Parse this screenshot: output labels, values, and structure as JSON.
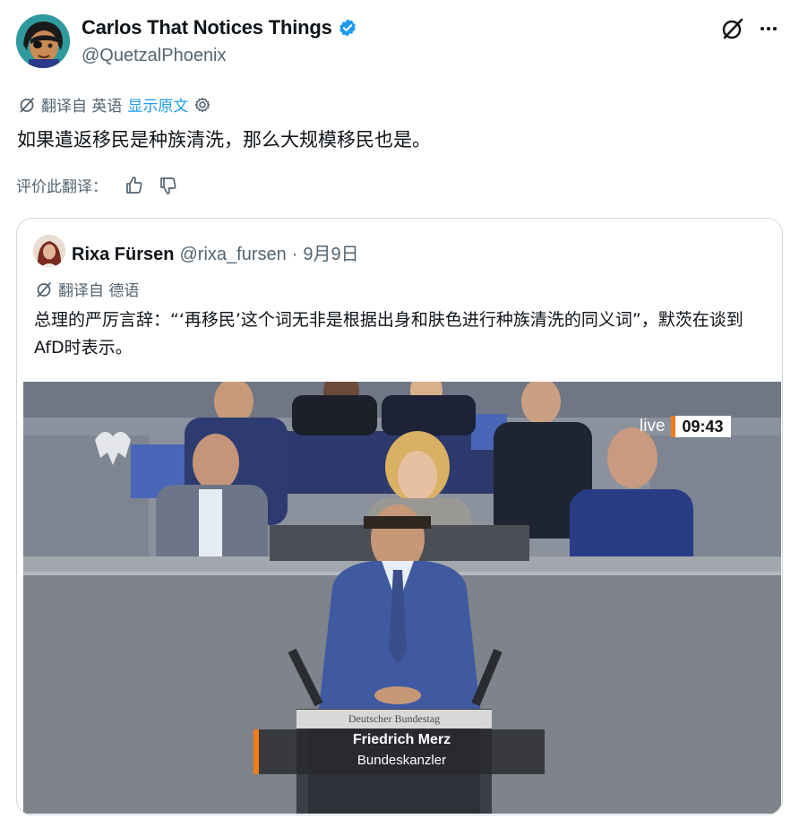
{
  "author": {
    "display_name": "Carlos That Notices Things",
    "handle": "@QuetzalPhoenix",
    "avatar_icon": "avatar-eyepatch",
    "verified_icon": "verified-badge-icon",
    "verified_color": "#1d9bf0"
  },
  "header_actions": {
    "grok_icon": "grok-icon",
    "more_icon": "more-dots-icon"
  },
  "translation": {
    "translated_from": "翻译自 英语",
    "show_original": "显示原文",
    "settings_icon": "gear-icon"
  },
  "tweet": {
    "text": "如果遣返移民是种族清洗，那么大规模移民也是。"
  },
  "rate": {
    "label": "评价此翻译：",
    "up_icon": "thumbs-up-icon",
    "down_icon": "thumbs-down-icon"
  },
  "quote": {
    "name": "Rixa Fürsen",
    "handle": "@rixa_fursen",
    "separator": "·",
    "date": "9月9日",
    "translated_from": "翻译自 德语",
    "text": "总理的严厉言辞：“‘再移民’这个词无非是根据出身和肤色进行种族清洗的同义词”，默茨在谈到AfD时表示。",
    "video": {
      "live_label": "live",
      "time": "09:43",
      "podium_label": "Deutscher Bundestag",
      "caption_name": "Friedrich Merz",
      "caption_title": "Bundeskanzler",
      "accent_color": "#ef7d1a"
    }
  }
}
